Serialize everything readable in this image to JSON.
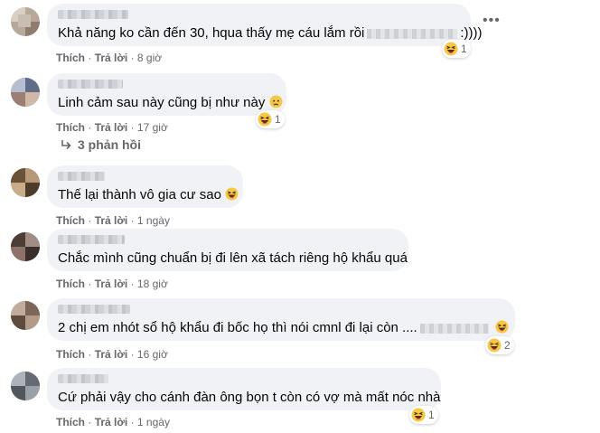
{
  "comments": [
    {
      "text": "Khả năng ko cần đến 30, hqua thấy mẹ cáu lắm rồi",
      "text_tail": ":))))",
      "like": "Thích",
      "reply": "Trả lời",
      "time": "8 giờ",
      "reaction_count": "1"
    },
    {
      "text": "Linh cảm sau này cũng bị như này",
      "like": "Thích",
      "reply": "Trả lời",
      "time": "17 giờ",
      "reaction_count": "1",
      "replies_label": "3 phản hồi"
    },
    {
      "text": "Thế lại thành vô gia cư sao",
      "like": "Thích",
      "reply": "Trả lời",
      "time": "1 ngày"
    },
    {
      "text": "Chắc mình cũng chuẩn bị đi lên xã tách riêng hộ khẩu quá",
      "like": "Thích",
      "reply": "Trả lời",
      "time": "18 giờ"
    },
    {
      "text": "2 chị em nhót sổ hộ khẩu đi bốc họ thì nói cmnl đi lại còn ....",
      "like": "Thích",
      "reply": "Trả lời",
      "time": "16 giờ",
      "reaction_count": "2"
    },
    {
      "text": "Cứ phải vậy cho cánh đàn ông bọn t còn có vợ mà mất nóc nhà",
      "like": "Thích",
      "reply": "Trả lời",
      "time": "1 ngày",
      "reaction_count": "1"
    }
  ],
  "more_label": "•••",
  "sep": "·",
  "colors": {
    "bubble": "#f0f2f5",
    "meta": "#65676b",
    "text": "#050505",
    "emoji_face": "#f7c843"
  }
}
